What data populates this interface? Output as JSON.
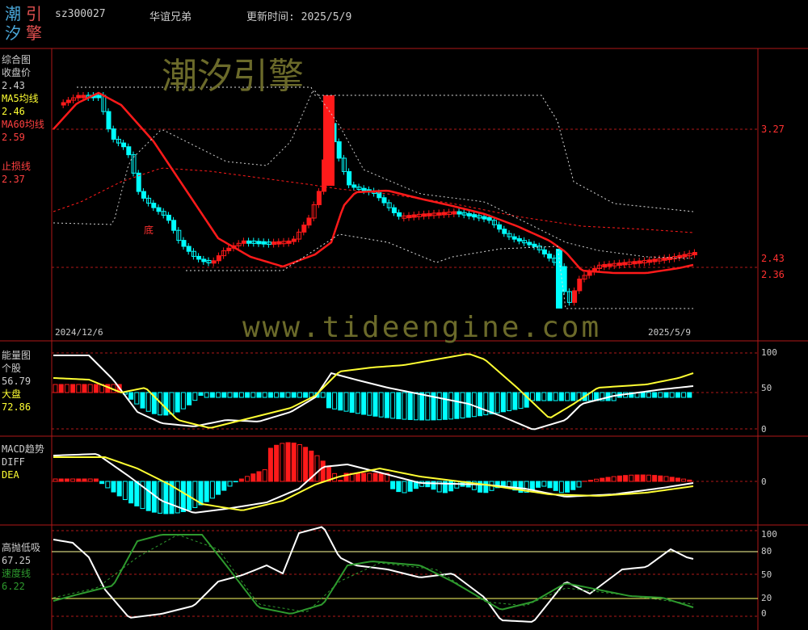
{
  "header": {
    "logo": [
      "潮",
      "引",
      "汐",
      "擎"
    ],
    "code": "sz300027",
    "name": "华谊兄弟",
    "update": "更新时间: 2025/5/9"
  },
  "watermark": {
    "top": "潮汐引擎",
    "bottom": "www.tideengine.com"
  },
  "colors": {
    "red": "#ff1a1a",
    "cyan": "#00ffff",
    "yellow": "#ffff33",
    "white": "#ffffff",
    "green": "#2e9a2e",
    "grid": "#b01818"
  },
  "panel1": {
    "labels": [
      {
        "text": "综合图",
        "color": "#ffffff"
      },
      {
        "text": "收盘价",
        "color": "#ffffff"
      },
      {
        "text": "2.43",
        "color": "#ffffff"
      },
      {
        "text": "MA5均线",
        "color": "#ffff33"
      },
      {
        "text": "2.46",
        "color": "#ffff33"
      },
      {
        "text": "MA60均线",
        "color": "#ff4040"
      },
      {
        "text": "2.59",
        "color": "#ff4040"
      },
      {
        "text": "",
        "color": "#000"
      },
      {
        "text": "止损线",
        "color": "#ff4040"
      },
      {
        "text": "2.37",
        "color": "#ff4040"
      }
    ],
    "price_labels": [
      "3.27",
      "2.43",
      "2.36"
    ],
    "date_start": "2024/12/6",
    "date_end": "2025/5/9",
    "bottom_mark": "底"
  },
  "panel2": {
    "labels": [
      {
        "text": "能量图",
        "color": "#ffffff"
      },
      {
        "text": "个股",
        "color": "#ffffff"
      },
      {
        "text": "56.79",
        "color": "#ffffff"
      },
      {
        "text": "大盘",
        "color": "#ffff33"
      },
      {
        "text": "72.86",
        "color": "#ffff33"
      }
    ],
    "scale": [
      "100",
      "50",
      "0"
    ]
  },
  "panel3": {
    "labels": [
      {
        "text": "MACD趋势",
        "color": "#ffffff"
      },
      {
        "text": "DIFF",
        "color": "#ffffff"
      },
      {
        "text": "DEA",
        "color": "#ffff33"
      }
    ],
    "scale": [
      "0"
    ]
  },
  "panel4": {
    "labels": [
      {
        "text": "高抛低吸",
        "color": "#ffffff"
      },
      {
        "text": "67.25",
        "color": "#ffffff"
      },
      {
        "text": "速度线",
        "color": "#2e9a2e"
      },
      {
        "text": "6.22",
        "color": "#2e9a2e"
      }
    ],
    "scale": [
      "100",
      "80",
      "50",
      "20",
      "0"
    ]
  }
}
